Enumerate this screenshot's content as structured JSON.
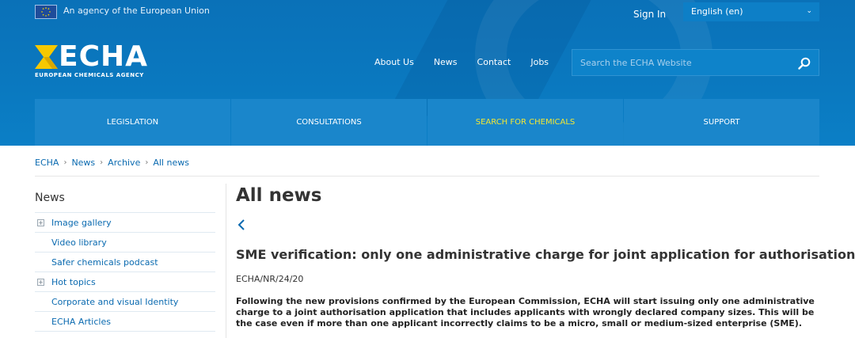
{
  "topbar": {
    "agency_text": "An agency of the European Union",
    "sign_in": "Sign In",
    "language": "English (en)"
  },
  "logo": {
    "word": "ECHA",
    "subtitle": "EUROPEAN CHEMICALS AGENCY"
  },
  "nav": {
    "items": [
      "About Us",
      "News",
      "Contact",
      "Jobs"
    ]
  },
  "search": {
    "placeholder": "Search the ECHA Website",
    "icon": "search-icon"
  },
  "tabs": [
    {
      "label": "LEGISLATION"
    },
    {
      "label": "CONSULTATIONS"
    },
    {
      "label": "SEARCH FOR CHEMICALS"
    },
    {
      "label": "SUPPORT"
    }
  ],
  "breadcrumb": [
    "ECHA",
    "News",
    "Archive",
    "All news"
  ],
  "sidebar": {
    "title": "News",
    "items": [
      {
        "label": "Image gallery",
        "expandable": true
      },
      {
        "label": "Video library",
        "expandable": false
      },
      {
        "label": "Safer chemicals podcast",
        "expandable": false
      },
      {
        "label": "Hot topics",
        "expandable": true
      },
      {
        "label": "Corporate and visual Identity",
        "expandable": false
      },
      {
        "label": "ECHA Articles",
        "expandable": false
      }
    ]
  },
  "main": {
    "page_title": "All news",
    "article_title": "SME verification: only one administrative charge for joint application for authorisation",
    "reference": "ECHA/NR/24/20",
    "lead": "Following the new provisions confirmed by the European Commission, ECHA  will start issuing only one administrative charge to a joint authorisation application that includes applicants with wrongly declared company sizes. This will be the case even if more than one applicant incorrectly claims to be a micro, small or medium-sized enterprise (SME)."
  },
  "colors": {
    "header_blue": "#0a78bf",
    "tab_blue": "#1a86cb",
    "highlight_yellow": "#f4e733",
    "link_blue": "#0a6ab0",
    "logo_yellow": "#f6c800"
  }
}
